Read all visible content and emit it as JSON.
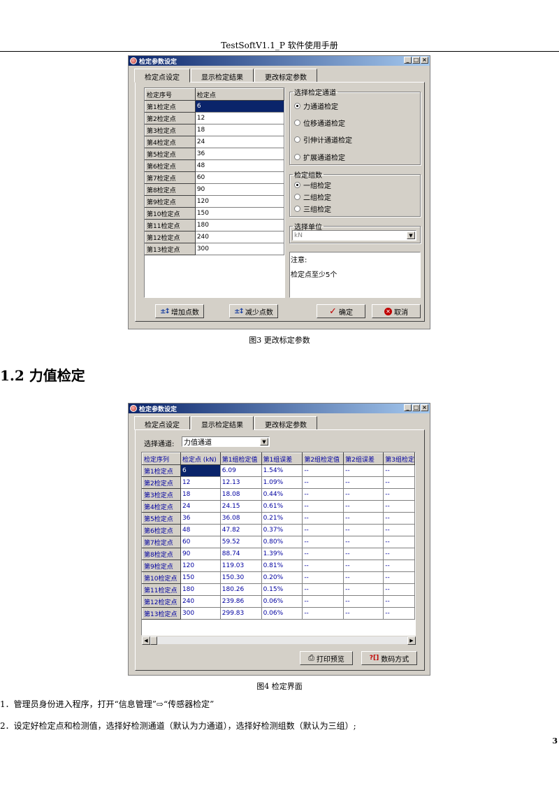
{
  "header": "TestSoftV1.1_P 软件使用手册",
  "win1": {
    "title": "检定参数设定",
    "tabs": [
      "检定点设定",
      "显示检定结果",
      "更改标定参数"
    ],
    "grid_headers": [
      "检定序号",
      "检定点"
    ],
    "points": [
      {
        "label": "第1检定点",
        "value": "6"
      },
      {
        "label": "第2检定点",
        "value": "12"
      },
      {
        "label": "第3检定点",
        "value": "18"
      },
      {
        "label": "第4检定点",
        "value": "24"
      },
      {
        "label": "第5检定点",
        "value": "36"
      },
      {
        "label": "第6检定点",
        "value": "48"
      },
      {
        "label": "第7检定点",
        "value": "60"
      },
      {
        "label": "第8检定点",
        "value": "90"
      },
      {
        "label": "第9检定点",
        "value": "120"
      },
      {
        "label": "第10检定点",
        "value": "150"
      },
      {
        "label": "第11检定点",
        "value": "180"
      },
      {
        "label": "第12检定点",
        "value": "240"
      },
      {
        "label": "第13检定点",
        "value": "300"
      }
    ],
    "channel_group": {
      "legend": "选择检定通道",
      "options": [
        "力通道检定",
        "位移通道检定",
        "引伸计通道检定",
        "扩展通道检定"
      ],
      "selected": 0
    },
    "count_group": {
      "legend": "检定组数",
      "options": [
        "一组检定",
        "二组检定",
        "三组检定"
      ],
      "selected": 0
    },
    "unit_group": {
      "legend": "选择单位",
      "value": "kN"
    },
    "notes": {
      "title": "注意:",
      "body": "检定点至少5个"
    },
    "buttons": {
      "add": "增加点数",
      "remove": "减少点数",
      "ok": "确定",
      "cancel": "取消"
    }
  },
  "caption1": "图3  更改标定参数",
  "section_title": "1.2 力值检定",
  "win2": {
    "title": "检定参数设定",
    "tabs": [
      "检定点设定",
      "显示检定结果",
      "更改标定参数"
    ],
    "channel_label": "选择通道:",
    "channel_value": "力值通道",
    "headers": [
      "检定序列",
      "检定点 (kN)",
      "第1组检定值",
      "第1组误差",
      "第2组检定值",
      "第2组误差",
      "第3组检定"
    ],
    "rows": [
      [
        "第1检定点",
        "6",
        "6.09",
        "1.54%",
        "--",
        "--",
        "--"
      ],
      [
        "第2检定点",
        "12",
        "12.13",
        "1.09%",
        "--",
        "--",
        "--"
      ],
      [
        "第3检定点",
        "18",
        "18.08",
        "0.44%",
        "--",
        "--",
        "--"
      ],
      [
        "第4检定点",
        "24",
        "24.15",
        "0.61%",
        "--",
        "--",
        "--"
      ],
      [
        "第5检定点",
        "36",
        "36.08",
        "0.21%",
        "--",
        "--",
        "--"
      ],
      [
        "第6检定点",
        "48",
        "47.82",
        "0.37%",
        "--",
        "--",
        "--"
      ],
      [
        "第7检定点",
        "60",
        "59.52",
        "0.80%",
        "--",
        "--",
        "--"
      ],
      [
        "第8检定点",
        "90",
        "88.74",
        "1.39%",
        "--",
        "--",
        "--"
      ],
      [
        "第9检定点",
        "120",
        "119.03",
        "0.81%",
        "--",
        "--",
        "--"
      ],
      [
        "第10检定点",
        "150",
        "150.30",
        "0.20%",
        "--",
        "--",
        "--"
      ],
      [
        "第11检定点",
        "180",
        "180.26",
        "0.15%",
        "--",
        "--",
        "--"
      ],
      [
        "第12检定点",
        "240",
        "239.86",
        "0.06%",
        "--",
        "--",
        "--"
      ],
      [
        "第13检定点",
        "300",
        "299.83",
        "0.06%",
        "--",
        "--",
        "--"
      ]
    ],
    "buttons": {
      "print": "打印预览",
      "digits": "数码方式"
    }
  },
  "caption2": "图4  检定界面",
  "steps": [
    "1．管理员身份进入程序，打开“信息管理”⇨“传感器检定”",
    "2．设定好检定点和检测值，选择好检测通道（默认为力通道），选择好检测组数（默认为三组）;"
  ],
  "page_number": "3"
}
